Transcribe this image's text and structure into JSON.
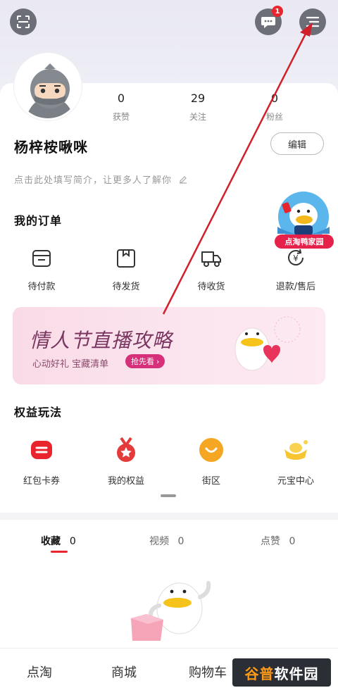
{
  "topbar": {
    "scan_icon": "scan-icon",
    "message_icon": "message-icon",
    "message_badge": "1",
    "menu_icon": "menu-icon"
  },
  "profile": {
    "stats": [
      {
        "value": "0",
        "label": "获赞"
      },
      {
        "value": "29",
        "label": "关注"
      },
      {
        "value": "0",
        "label": "粉丝"
      }
    ],
    "username": "杨梓桉啾咪",
    "edit_label": "编辑",
    "bio_placeholder": "点击此处填写简介，让更多人了解你"
  },
  "orders": {
    "title": "我的订单",
    "items": [
      {
        "label": "待付款",
        "icon": "wallet-icon"
      },
      {
        "label": "待发货",
        "icon": "package-icon"
      },
      {
        "label": "待收货",
        "icon": "truck-icon"
      },
      {
        "label": "退款/售后",
        "icon": "refund-icon"
      }
    ],
    "duck_badge_label": "点淘鸭家园"
  },
  "banner": {
    "title": "情人节直播攻略",
    "subtitle": "心动好礼 宝藏清单",
    "cta": "抢先看"
  },
  "benefits": {
    "title": "权益玩法",
    "items": [
      {
        "label": "红包卡券",
        "icon": "red-packet-icon",
        "color": "#e8242c"
      },
      {
        "label": "我的权益",
        "icon": "medal-icon",
        "color": "#e53a3a"
      },
      {
        "label": "街区",
        "icon": "chat-bubble-icon",
        "color": "#f5a623"
      },
      {
        "label": "元宝中心",
        "icon": "ingot-icon",
        "color": "#f7c531"
      }
    ]
  },
  "content_tabs": [
    {
      "label": "收藏",
      "count": "0"
    },
    {
      "label": "视频",
      "count": "0"
    },
    {
      "label": "点赞",
      "count": "0"
    }
  ],
  "bottom_nav": [
    {
      "label": "点淘"
    },
    {
      "label": "商城"
    },
    {
      "label": "购物车"
    }
  ],
  "watermark": {
    "part1": "谷普",
    "part2": "软件园"
  }
}
